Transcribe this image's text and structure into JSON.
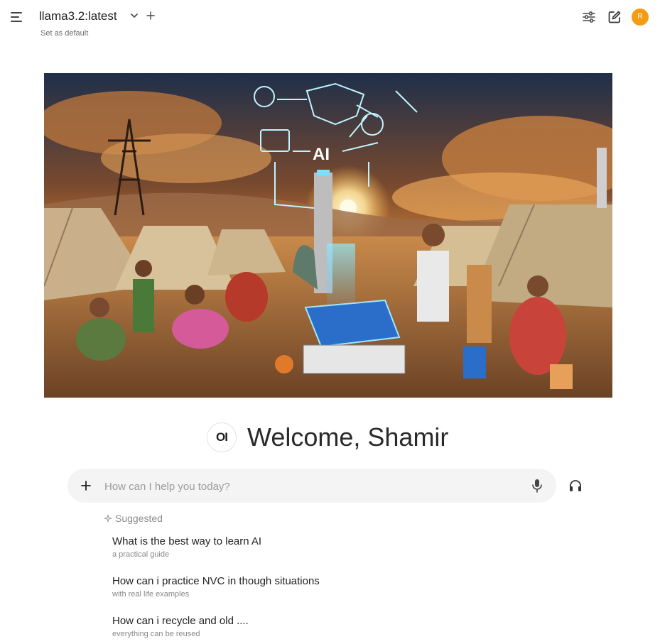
{
  "header": {
    "model_name": "llama3.2:latest",
    "set_default_label": "Set as default",
    "avatar_initial": "R"
  },
  "welcome": {
    "logo_text": "OI",
    "message": "Welcome, Shamir"
  },
  "chat_input": {
    "placeholder": "How can I help you today?",
    "value": ""
  },
  "suggested": {
    "label": "Suggested",
    "items": [
      {
        "title": "What is the best way to learn AI",
        "subtitle": "a practical guide"
      },
      {
        "title": "How can i practice NVC in though situations",
        "subtitle": "with real life examples"
      },
      {
        "title": "How can i recycle and old ....",
        "subtitle": "everything can be reused"
      }
    ]
  },
  "hero_image": {
    "caption": "AI"
  },
  "icons": {
    "menu": "hamburger-icon",
    "chevron": "chevron-down-icon",
    "plus": "plus-icon",
    "controls": "sliders-icon",
    "new_chat": "edit-icon",
    "mic": "microphone-icon",
    "headphones": "headphones-icon",
    "sparkle": "sparkle-icon"
  },
  "colors": {
    "accent_avatar": "#f39c12",
    "input_bg": "#f4f4f4"
  }
}
